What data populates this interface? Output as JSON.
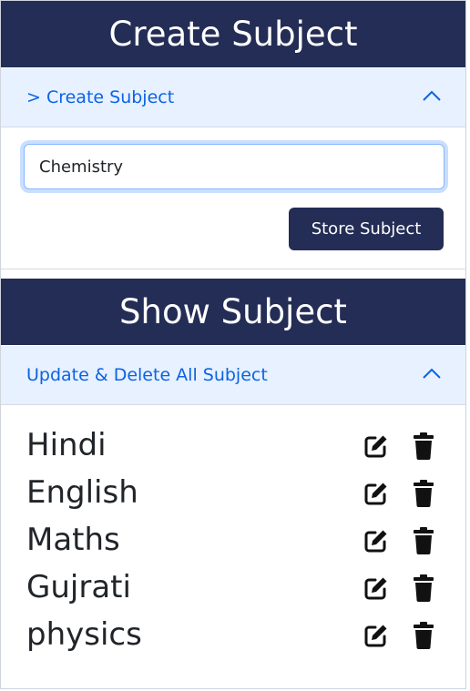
{
  "create_section": {
    "title": "Create Subject",
    "accordion_label": "> Create Subject",
    "input_value": "Chemistry",
    "store_button_label": "Store Subject"
  },
  "show_section": {
    "title": "Show Subject",
    "accordion_label": "Update & Delete All Subject",
    "subjects": [
      {
        "name": "Hindi"
      },
      {
        "name": "English"
      },
      {
        "name": "Maths"
      },
      {
        "name": "Gujrati"
      },
      {
        "name": "physics"
      }
    ]
  },
  "icons": {
    "collapse": "chevron-up-icon",
    "edit": "edit-icon",
    "delete": "trash-icon"
  },
  "colors": {
    "header_bg": "#232d55",
    "accordion_bg": "#e7f1ff",
    "accordion_text": "#0c63e4",
    "button_bg": "#232d55"
  }
}
